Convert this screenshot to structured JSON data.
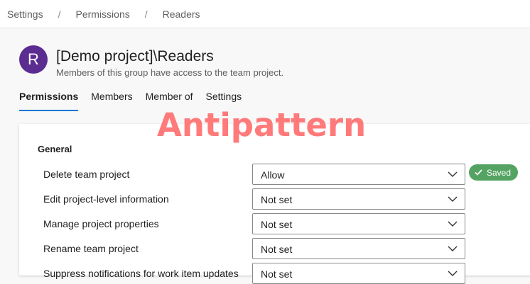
{
  "breadcrumb": [
    "Settings",
    "Permissions",
    "Readers"
  ],
  "breadcrumb_separator": "/",
  "group": {
    "avatar_letter": "R",
    "title": "[Demo project]\\Readers",
    "subtitle": "Members of this group have access to the team project."
  },
  "tabs": [
    "Permissions",
    "Members",
    "Member of",
    "Settings"
  ],
  "active_tab": "Permissions",
  "watermark": "Antipattern",
  "section_title": "General",
  "permissions": [
    {
      "label": "Delete team project",
      "value": "Allow"
    },
    {
      "label": "Edit project-level information",
      "value": "Not set"
    },
    {
      "label": "Manage project properties",
      "value": "Not set"
    },
    {
      "label": "Rename team project",
      "value": "Not set"
    },
    {
      "label": "Suppress notifications for work item updates",
      "value": "Not set"
    }
  ],
  "saved_badge": "Saved",
  "icons": {
    "dropdown": "chevron-down-icon",
    "saved": "checkmark-icon"
  },
  "colors": {
    "accent": "#0078d4",
    "avatar": "#5c2d91",
    "saved": "#55a362",
    "watermark": "#ff7a7a"
  }
}
